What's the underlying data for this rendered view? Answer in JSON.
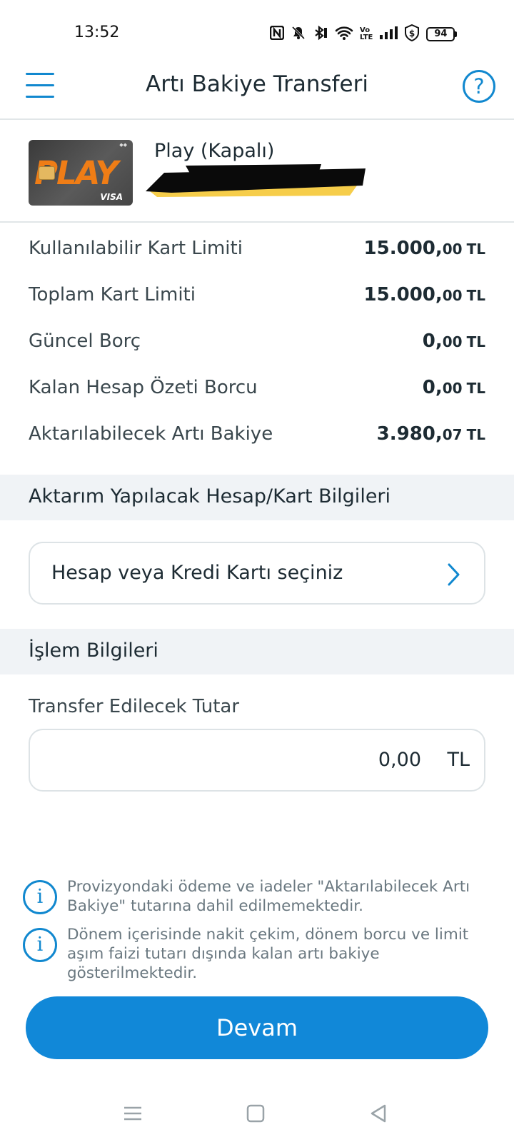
{
  "status_bar": {
    "time": "13:52",
    "icons": [
      "nfc-icon",
      "mute-icon",
      "bluetooth-icon",
      "wifi-icon",
      "volte-icon",
      "signal-icon",
      "shield-dollar-icon",
      "battery-icon"
    ],
    "battery_level": "94"
  },
  "header": {
    "title": "Artı Bakiye Transferi",
    "help_label": "?"
  },
  "card": {
    "name": "Play (Kapalı)",
    "card_brand_text": "PLAY",
    "card_network": "VISA"
  },
  "info": [
    {
      "label": "Kullanılabilir Kart Limiti",
      "value": "15.000,",
      "cents": "00",
      "currency": "TL"
    },
    {
      "label": "Toplam Kart Limiti",
      "value": "15.000,",
      "cents": "00",
      "currency": "TL"
    },
    {
      "label": "Güncel Borç",
      "value": "0,",
      "cents": "00",
      "currency": "TL"
    },
    {
      "label": "Kalan Hesap Özeti Borcu",
      "value": "0,",
      "cents": "00",
      "currency": "TL"
    },
    {
      "label": "Aktarılabilecek Artı Bakiye",
      "value": "3.980,",
      "cents": "07",
      "currency": "TL"
    }
  ],
  "target_section": {
    "title": "Aktarım Yapılacak Hesap/Kart Bilgileri",
    "select_placeholder": "Hesap veya Kredi Kartı seçiniz"
  },
  "transaction_section": {
    "title": "İşlem Bilgileri",
    "amount_label": "Transfer Edilecek Tutar",
    "amount_value": "0,00",
    "amount_currency": "TL"
  },
  "notes": [
    {
      "text": "Provizyondaki ödeme ve iadeler \"Aktarılabilecek Artı Bakiye\" tutarına dahil edilmemektedir."
    },
    {
      "text": "Dönem içerisinde nakit çekim, dönem borcu ve limit aşım faizi tutarı dışında kalan artı bakiye gösterilmektedir."
    }
  ],
  "continue_label": "Devam",
  "colors": {
    "accent": "#1188d8",
    "section_bg": "#f0f3f6",
    "card_orange": "#ef7d16"
  }
}
